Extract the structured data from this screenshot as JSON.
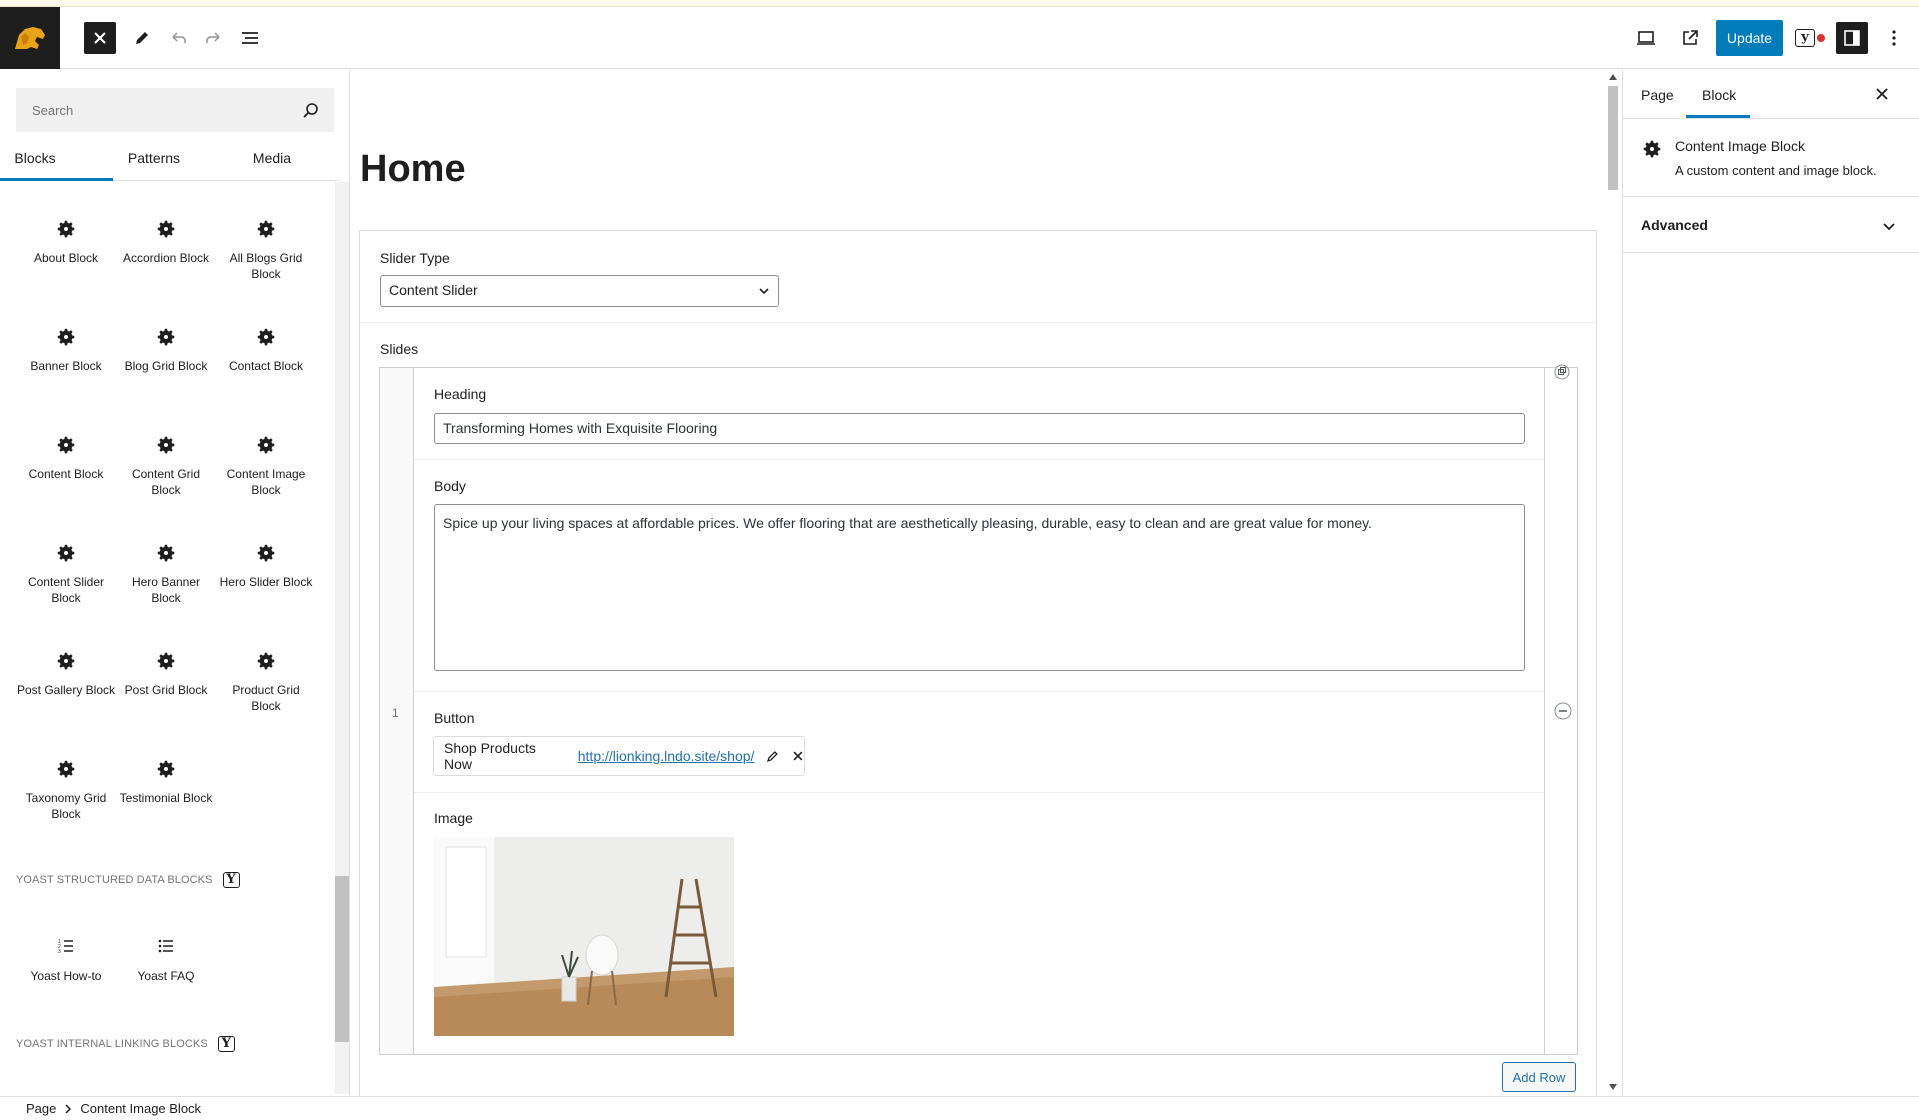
{
  "topbar": {
    "update_label": "Update",
    "icons": [
      "logo-icon",
      "close-icon",
      "pencil-icon",
      "undo-icon",
      "redo-icon",
      "list-view-icon",
      "desktop-preview-icon",
      "external-link-icon",
      "yoast-icon",
      "sidebar-toggle-icon",
      "more-options-icon"
    ]
  },
  "inserter": {
    "search_placeholder": "Search",
    "tabs": [
      "Blocks",
      "Patterns",
      "Media"
    ],
    "blocks": [
      "About Block",
      "Accordion Block",
      "All Blogs Grid Block",
      "Banner Block",
      "Blog Grid Block",
      "Contact Block",
      "Content Block",
      "Content Grid Block",
      "Content Image Block",
      "Content Slider Block",
      "Hero Banner Block",
      "Hero Slider Block",
      "Post Gallery Block",
      "Post Grid Block",
      "Product Grid Block",
      "Taxonomy Grid Block",
      "Testimonial Block"
    ],
    "yoast_structured_title": "YOAST STRUCTURED DATA BLOCKS",
    "yoast_blocks": [
      "Yoast How-to",
      "Yoast FAQ"
    ],
    "yoast_linking_title": "YOAST INTERNAL LINKING BLOCKS"
  },
  "canvas": {
    "page_title": "Home",
    "slider_type_label": "Slider Type",
    "slider_type_value": "Content Slider",
    "slides_label": "Slides",
    "row_number": "1",
    "heading_label": "Heading",
    "heading_value": "Transforming Homes with Exquisite Flooring",
    "body_label": "Body",
    "body_value": "Spice up your living spaces at affordable prices. We offer flooring that are aesthetically pleasing, durable, easy to clean and are great value for money.",
    "button_label": "Button",
    "button_text": "Shop Products Now",
    "button_url": "http://lionking.lndo.site/shop/",
    "image_label": "Image",
    "add_row_label": "Add Row"
  },
  "settings": {
    "tabs": [
      "Page",
      "Block"
    ],
    "active_tab": "Block",
    "block_title": "Content Image Block",
    "block_description": "A custom content and image block.",
    "advanced_label": "Advanced"
  },
  "footer": {
    "breadcrumb": [
      "Page",
      "Content Image Block"
    ]
  },
  "colors": {
    "accent": "#007cba",
    "dark": "#1e1e1e",
    "link": "#2271b1"
  }
}
